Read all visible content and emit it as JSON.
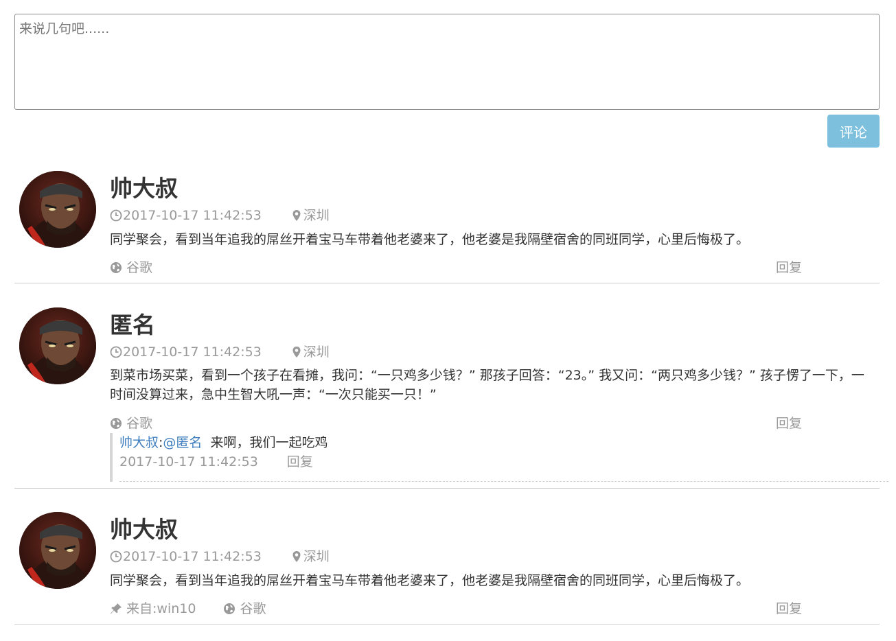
{
  "composer": {
    "placeholder": "来说几句吧......",
    "submit_label": "评论"
  },
  "comments": [
    {
      "name": "帅大叔",
      "time": "2017-10-17 11:42:53",
      "location": "深圳",
      "text": "同学聚会，看到当年追我的屌丝开着宝马车带着他老婆来了，他老婆是我隔壁宿舍的同班同学，心里后悔极了。",
      "browser": "谷歌",
      "reply_label": "回复"
    },
    {
      "name": "匿名",
      "time": "2017-10-17 11:42:53",
      "location": "深圳",
      "text": "到菜市场买菜，看到一个孩子在看摊，我问：“一只鸡多少钱？” 那孩子回答：“23。” 我又问：“两只鸡多少钱？” 孩子愣了一下，一时间没算过来，急中生智大吼一声：“一次只能买一只！”",
      "browser": "谷歌",
      "reply_label": "回复",
      "sub_reply": {
        "author": "帅大叔",
        "separator": ":",
        "mention": "@匿名",
        "text": "来啊，我们一起吃鸡",
        "time": "2017-10-17 11:42:53",
        "reply_label": "回复"
      }
    },
    {
      "name": "帅大叔",
      "time": "2017-10-17 11:42:53",
      "location": "深圳",
      "text": "同学聚会，看到当年追我的屌丝开着宝马车带着他老婆来了，他老婆是我隔壁宿舍的同班同学，心里后悔极了。",
      "source": "来自:win10",
      "browser": "谷歌",
      "reply_label": "回复"
    }
  ],
  "icons": {
    "clock": "clock-icon",
    "location": "map-marker-icon",
    "globe": "globe-icon",
    "pin": "pushpin-icon"
  },
  "colors": {
    "button": "#7dc0de",
    "link": "#3f7fbf",
    "muted": "#999999"
  }
}
